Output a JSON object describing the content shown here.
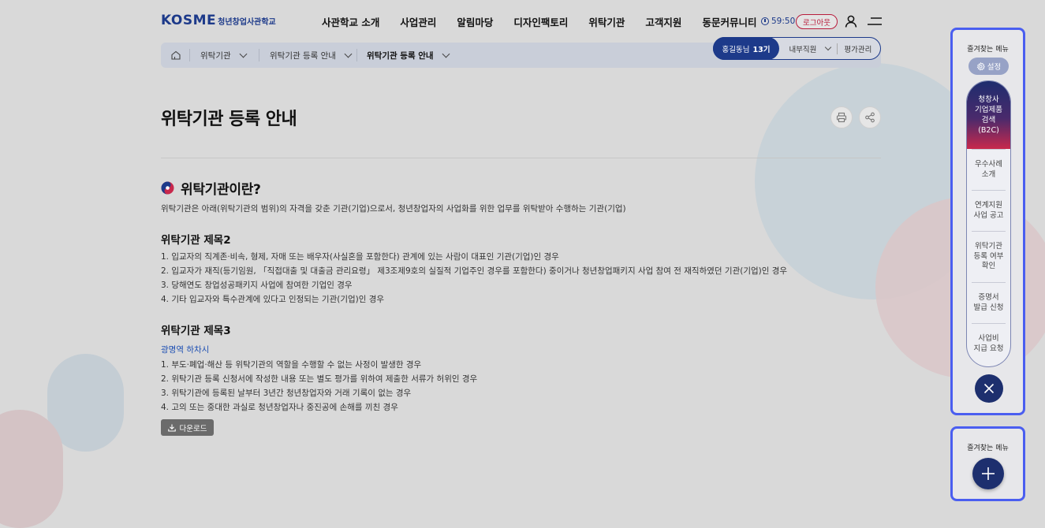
{
  "header": {
    "logo_main": "KOSME",
    "logo_sub": "청년창업사관학교",
    "nav": [
      "사관학교 소개",
      "사업관리",
      "알림마당",
      "디자인팩토리",
      "위탁기관",
      "고객지원",
      "동문커뮤니티"
    ],
    "timer": "59:50",
    "logout_label": "로그아웃"
  },
  "breadcrumb": {
    "items": [
      "위탁기관",
      "위탁기관 등록 안내",
      "위탁기관 등록 안내"
    ]
  },
  "role": {
    "name": "홍길동님",
    "cohort": "13기",
    "select_label": "내부직원",
    "eval_label": "평가관리"
  },
  "page": {
    "title": "위탁기관 등록 안내",
    "section_title": "위탁기관이란?",
    "intro": "위탁기관은 아래(위탁기관의 범위)의 자격을 갖춘 기관(기업)으로서, 청년창업자의 사업화를 위한 업무를 위탁받아 수행하는 기관(기업)",
    "sub1": "위탁기관 제목2",
    "list1": [
      "1. 입교자의 직계존·비속, 형제, 자매 또는 배우자(사실혼을 포함한다) 관계에 있는 사람이 대표인 기관(기업)인 경우",
      "2. 입교자가 재직(등기임원, 「직접대출 및 대출금 관리요령」 제3조제9호의 실질적 기업주인 경우를 포함한다) 중이거나 청년창업패키지 사업 참여 전 재직하였던 기관(기업)인 경우",
      "3. 당해연도 창업성공패키지 사업에 참여한 기업인 경우",
      "4. 기타 입교자와 특수관계에 있다고 인정되는 기관(기업)인 경우"
    ],
    "sub2": "위탁기관 제목3",
    "link": "광명역 하차시",
    "list2": [
      "1. 부도·폐업·해산 등 위탁기관의 역할을 수행할 수 없는 사정이 발생한 경우",
      "2. 위탁기관 등록 신청서에 작성한 내용 또는 별도 평가를 위하여 제출한 서류가 허위인 경우",
      "3. 위탁기관에 등록된 날부터 3년간 청년창업자와 거래 기록이 없는 경우",
      "4. 고의 또는 중대한 과실로 청년창업자나 중진공에 손해를 끼친 경우"
    ],
    "download_label": "다운로드"
  },
  "favorites": {
    "title": "즐겨찾는 메뉴",
    "settings_label": "설정",
    "top_item": [
      "청창사",
      "기업제품",
      "검색",
      "(B2C)"
    ],
    "items": [
      [
        "우수사례",
        "소개"
      ],
      [
        "연계지원",
        "사업 공고"
      ],
      [
        "위탁기관",
        "등록 여부",
        "확인"
      ],
      [
        "증명서",
        "발급 신청"
      ],
      [
        "사업비",
        "지급 요청"
      ]
    ],
    "title_2": "즐겨찾는 메뉴"
  },
  "colors": {
    "brand": "#1d3a8a",
    "accent_red": "#b81c3c",
    "panel_border": "#4a5ef0"
  }
}
